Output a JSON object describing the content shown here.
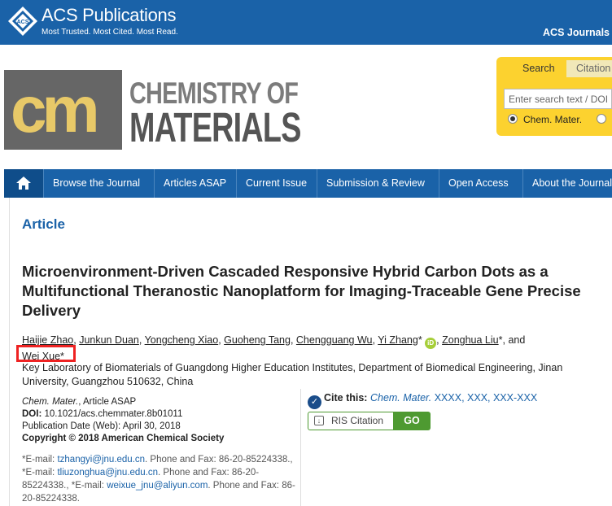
{
  "brand": {
    "name": "ACS Publications",
    "tagline": "Most Trusted. Most Cited. Most Read.",
    "journals_link": "ACS Journals",
    "color": "#1a62a8"
  },
  "journal": {
    "logo_letters": "cm",
    "name_line1": "CHEMISTRY OF",
    "name_line2": "MATERIALS"
  },
  "search": {
    "tabs": [
      "Search",
      "Citation"
    ],
    "placeholder": "Enter search text / DOI",
    "scope_option": "Chem. Mater."
  },
  "nav": {
    "items": [
      "Browse the Journal",
      "Articles ASAP",
      "Current Issue",
      "Submission & Review",
      "Open Access",
      "About the Journal"
    ]
  },
  "article": {
    "type_label": "Article",
    "title": "Microenvironment-Driven Cascaded Responsive Hybrid Carbon Dots as a Multifunctional Theranostic Nanoplatform for Imaging-Traceable Gene Precise Delivery",
    "authors": [
      "Haijie Zhao",
      "Junkun Duan",
      "Yongcheng Xiao",
      "Guoheng Tang",
      "Chengguang Wu",
      "Yi Zhang",
      "Zonghua Liu",
      "Wei Xue"
    ],
    "and_word": "and",
    "affiliation": "Key Laboratory of Biomaterials of Guangdong Higher Education Institutes, Department of Biomedical Engineering, Jinan University, Guangzhou 510632, China",
    "journal_abbr": "Chem. Mater.",
    "status": ", Article ASAP",
    "doi_label": "DOI:",
    "doi": "10.1021/acs.chemmater.8b01011",
    "pub_date": "Publication Date (Web): April 30, 2018",
    "copyright": "Copyright © 2018 American Chemical Society",
    "emails": {
      "prefix": "*E-mail:",
      "e1": "tzhangyi@jnu.edu.cn",
      "phone1": ". Phone and Fax: 86-20-85224338., *E-mail:",
      "e2": "tliuzonghua@jnu.edu.cn",
      "phone2": ". Phone and Fax: 86-20-85224338., *E-mail:",
      "e3": "weixue_jnu@aliyun.com",
      "phone3": ". Phone and Fax: 86-20-85224338."
    }
  },
  "cite": {
    "label": "Cite this:",
    "journal": "Chem. Mater.",
    "values": "XXXX, XXX, XXX-XXX",
    "ris_label": "RIS Citation",
    "go_label": "GO"
  },
  "orcid_label": "iD"
}
